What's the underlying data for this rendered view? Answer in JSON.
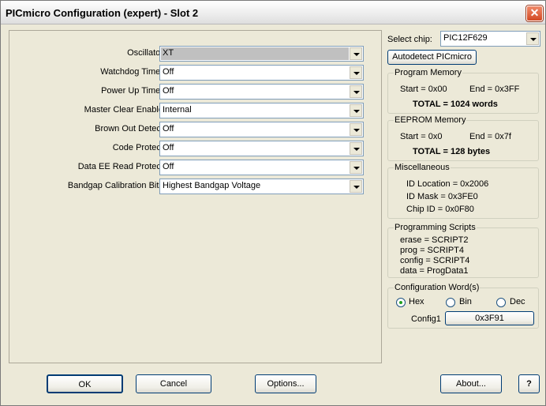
{
  "window": {
    "title": "PICmicro Configuration (expert) - Slot 2",
    "close_glyph": "✕"
  },
  "config_fields": [
    {
      "label": "Oscillator:",
      "value": "XT"
    },
    {
      "label": "Watchdog Timer:",
      "value": "Off"
    },
    {
      "label": "Power Up Timer:",
      "value": "Off"
    },
    {
      "label": "Master Clear Enable:",
      "value": "Internal"
    },
    {
      "label": "Brown Out Detect:",
      "value": "Off"
    },
    {
      "label": "Code Protect:",
      "value": "Off"
    },
    {
      "label": "Data EE Read Protect:",
      "value": "Off"
    },
    {
      "label": "Bandgap Calibration Bits:",
      "value": "Highest Bandgap Voltage"
    }
  ],
  "chip": {
    "label": "Select chip:",
    "value": "PIC12F629",
    "autodetect_label": "Autodetect PICmicro"
  },
  "program_memory": {
    "title": "Program Memory",
    "start": "Start = 0x00",
    "end": "End = 0x3FF",
    "total": "TOTAL = 1024 words"
  },
  "eeprom_memory": {
    "title": "EEPROM Memory",
    "start": "Start = 0x0",
    "end": "End = 0x7f",
    "total": "TOTAL = 128 bytes"
  },
  "misc": {
    "title": "Miscellaneous",
    "id_location": "ID Location = 0x2006",
    "id_mask": "ID Mask = 0x3FE0",
    "chip_id": "Chip ID = 0x0F80"
  },
  "scripts": {
    "title": "Programming Scripts",
    "erase": "erase = SCRIPT2",
    "prog": "prog = SCRIPT4",
    "config": "config = SCRIPT4",
    "data": "data = ProgData1"
  },
  "config_words": {
    "title": "Configuration Word(s)",
    "radio_hex": "Hex",
    "radio_bin": "Bin",
    "radio_dec": "Dec",
    "selected_format": "Hex",
    "config1_label": "Config1",
    "config1_value": "0x3F91"
  },
  "buttons": {
    "ok": "OK",
    "cancel": "Cancel",
    "options": "Options...",
    "about": "About...",
    "help": "?"
  }
}
